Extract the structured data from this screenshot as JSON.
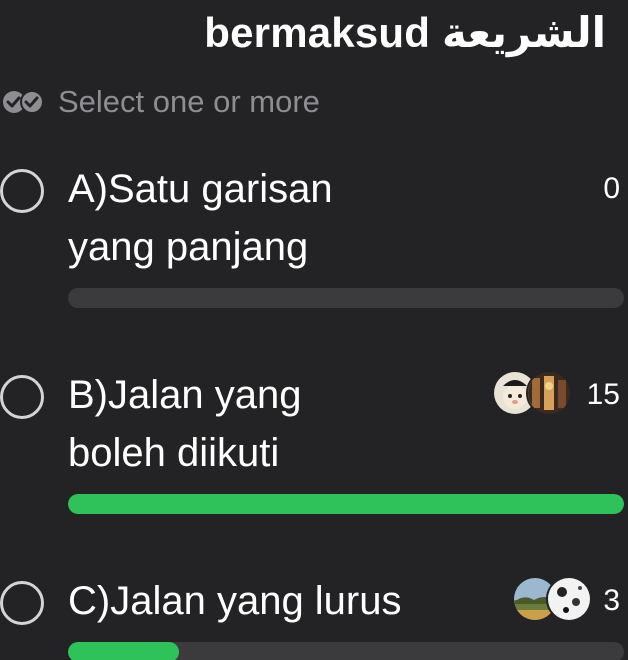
{
  "poll": {
    "title": "bermaksud الشريعة",
    "subtitle": "Select one or more",
    "subtitle_icon": "double-check-icon",
    "accent_color": "#2fc15a",
    "options": [
      {
        "label": "A)Satu garisan\nyang panjang",
        "votes": "0",
        "fill_fraction": 0
      },
      {
        "label": "B)Jalan yang\nboleh diikuti",
        "votes": "15",
        "fill_fraction": 1.0
      },
      {
        "label": "C)Jalan yang lurus",
        "votes": "3",
        "fill_fraction": 0.2
      }
    ]
  }
}
